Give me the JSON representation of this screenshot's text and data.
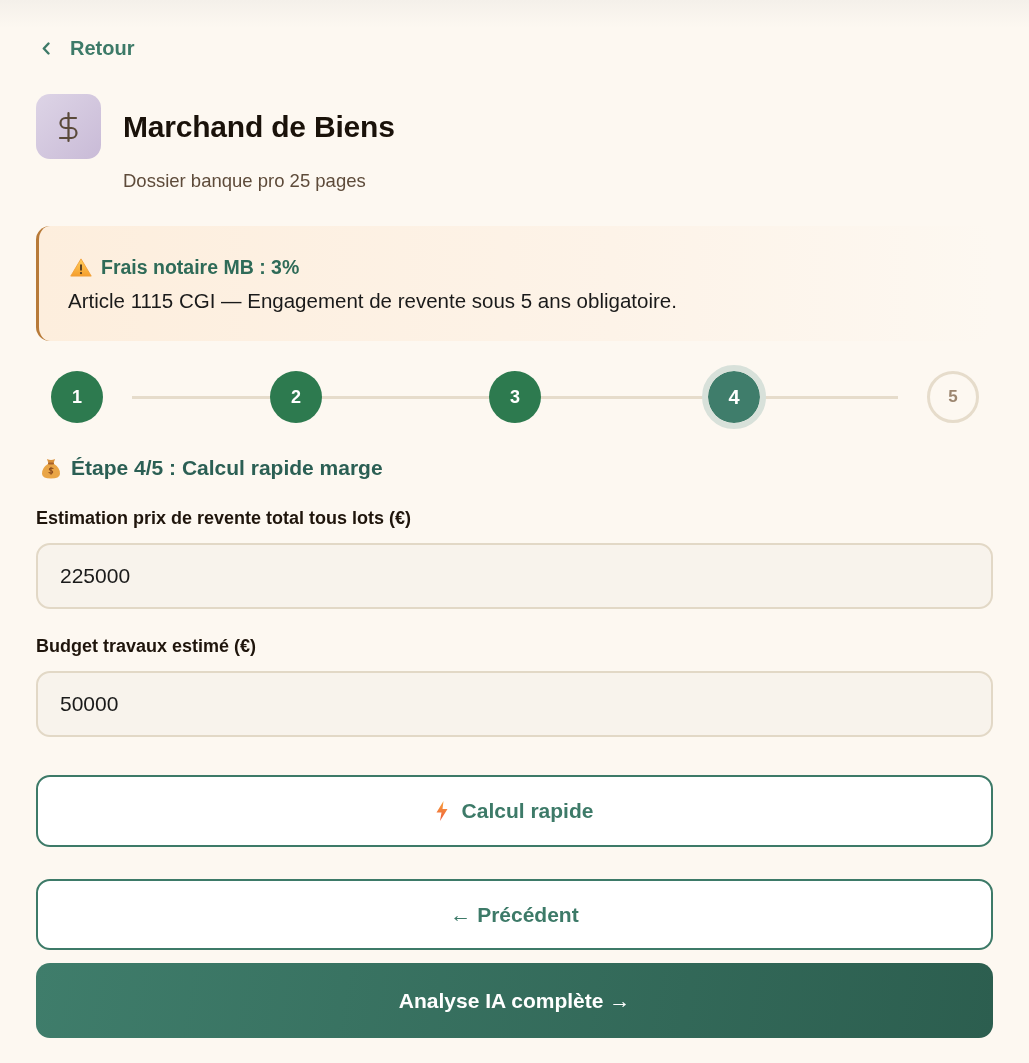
{
  "back_link": {
    "label": "Retour"
  },
  "header": {
    "title": "Marchand de Biens",
    "subtitle": "Dossier banque pro 25 pages"
  },
  "alert": {
    "title": "Frais notaire MB : 3%",
    "text": "Article 1115 CGI — Engagement de revente sous 5 ans obligatoire."
  },
  "steps": [
    {
      "label": "1",
      "done": true,
      "current": false
    },
    {
      "label": "2",
      "done": true,
      "current": false
    },
    {
      "label": "3",
      "done": true,
      "current": false
    },
    {
      "label": "4",
      "done": false,
      "current": true
    },
    {
      "label": "5",
      "done": false,
      "current": false
    }
  ],
  "step_heading": "Étape 4/5 : Calcul rapide marge",
  "fields": [
    {
      "label": "Estimation prix de revente total tous lots (€)",
      "value": "225000"
    },
    {
      "label": "Budget travaux estimé (€)",
      "value": "50000"
    }
  ],
  "quick_calc_button": {
    "label": "Calcul rapide"
  },
  "nav_buttons": [
    {
      "label": "← Précédent",
      "kind": "secondary"
    },
    {
      "label": "Analyse IA complète →",
      "kind": "primary"
    }
  ]
}
